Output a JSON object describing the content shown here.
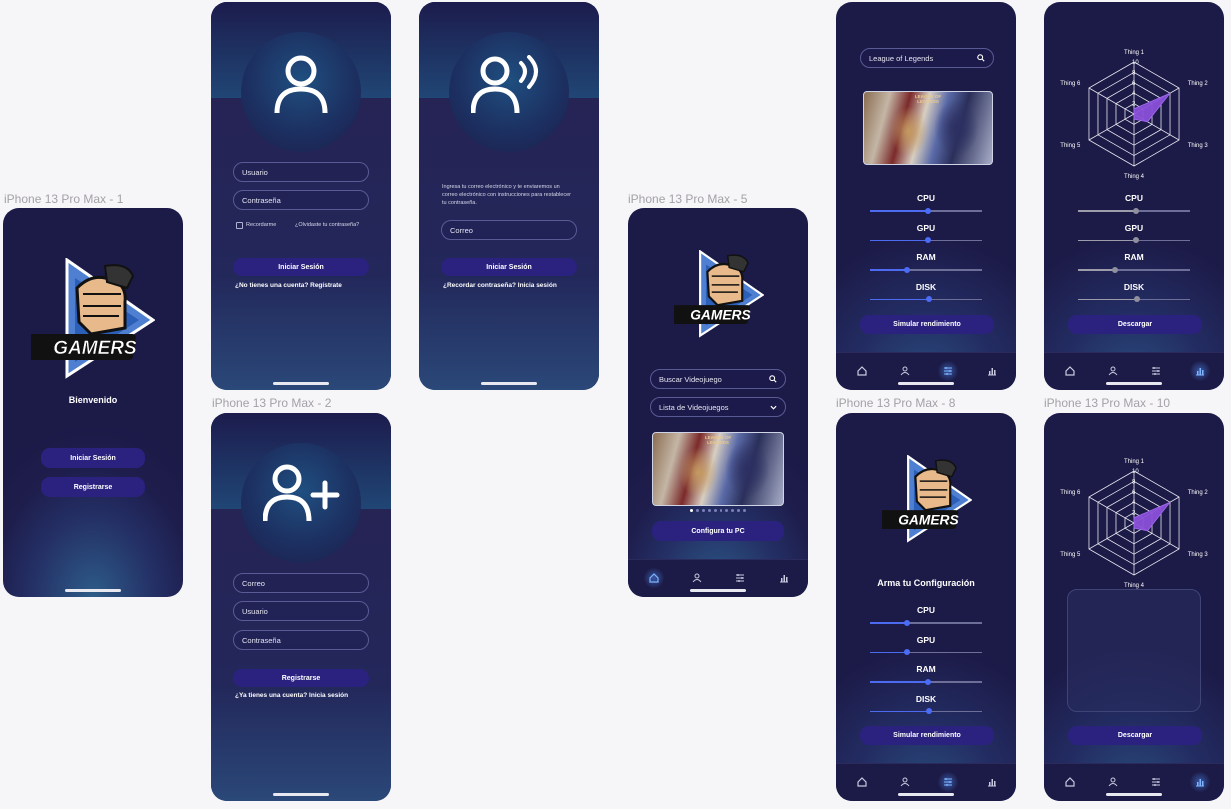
{
  "frames": {
    "f1": "iPhone 13 Pro Max - 1",
    "f2": "iPhone 13 Pro Max - 2",
    "f5": "iPhone 13 Pro Max - 5",
    "f8": "iPhone 13 Pro Max - 8",
    "f10": "iPhone 13 Pro Max - 10"
  },
  "logo": {
    "text": "GAMERS"
  },
  "welcome": {
    "title": "Bienvenido",
    "login_button": "Iniciar Sesión",
    "register_button": "Registrarse"
  },
  "login": {
    "username_placeholder": "Usuario",
    "password_placeholder": "Contraseña",
    "remember_label": "Recordarme",
    "forgot_link": "¿Olvidaste tu contraseña?",
    "submit_button": "Iniciar Sesión",
    "register_prompt": "¿No tienes una cuenta? Regístrate"
  },
  "recover": {
    "instructions": "Ingresa tu correo electrónico y te enviaremos un correo electrónico con instrucciones para restablecer tu contraseña.",
    "email_placeholder": "Correo",
    "submit_button": "Iniciar Sesión",
    "back_link": "¿Recordar contraseña? Inicia sesión"
  },
  "register": {
    "email_placeholder": "Correo",
    "username_placeholder": "Usuario",
    "password_placeholder": "Contraseña",
    "submit_button": "Registrarse",
    "login_prompt": "¿Ya tienes una cuenta? Inicia sesión"
  },
  "home": {
    "search_placeholder": "Buscar Videojuego",
    "list_select": "Lista de Videojuegos",
    "configure_button": "Configura tu PC",
    "carousel_dots": 10
  },
  "game_art": {
    "caption": "LEAGUE OF LEGENDS"
  },
  "performance": {
    "search_value": "League of Legends",
    "sliders": [
      {
        "label": "CPU",
        "value": 0.52
      },
      {
        "label": "GPU",
        "value": 0.52
      },
      {
        "label": "RAM",
        "value": 0.33
      },
      {
        "label": "DISK",
        "value": 0.53
      }
    ],
    "simulate_button": "Simular rendimiento"
  },
  "results": {
    "sliders": [
      {
        "label": "CPU",
        "value": 0.52
      },
      {
        "label": "GPU",
        "value": 0.52
      },
      {
        "label": "RAM",
        "value": 0.33
      },
      {
        "label": "DISK",
        "value": 0.53
      }
    ],
    "download_button": "Descargar"
  },
  "config": {
    "title": "Arma tu Configuración",
    "sliders": [
      {
        "label": "CPU",
        "value": 0.33
      },
      {
        "label": "GPU",
        "value": 0.33
      },
      {
        "label": "RAM",
        "value": 0.52
      },
      {
        "label": "DISK",
        "value": 0.53
      }
    ],
    "simulate_button": "Simular rendimiento"
  },
  "radar": {
    "axes": [
      "Thing 1",
      "Thing 2",
      "Thing 3",
      "Thing 4",
      "Thing 5",
      "Thing 6"
    ],
    "scale_labels": [
      "10",
      "8",
      "6",
      "4",
      "2"
    ],
    "values": [
      1,
      8,
      3,
      1,
      0,
      0
    ],
    "max": 10
  },
  "colors": {
    "accent": "#4a6cf7",
    "button": "#2b2280",
    "background": "#1c1a47",
    "radar_fill": "#8a4fd8"
  },
  "tabs": [
    "home-icon",
    "profile-icon",
    "sliders-icon",
    "stats-icon"
  ]
}
